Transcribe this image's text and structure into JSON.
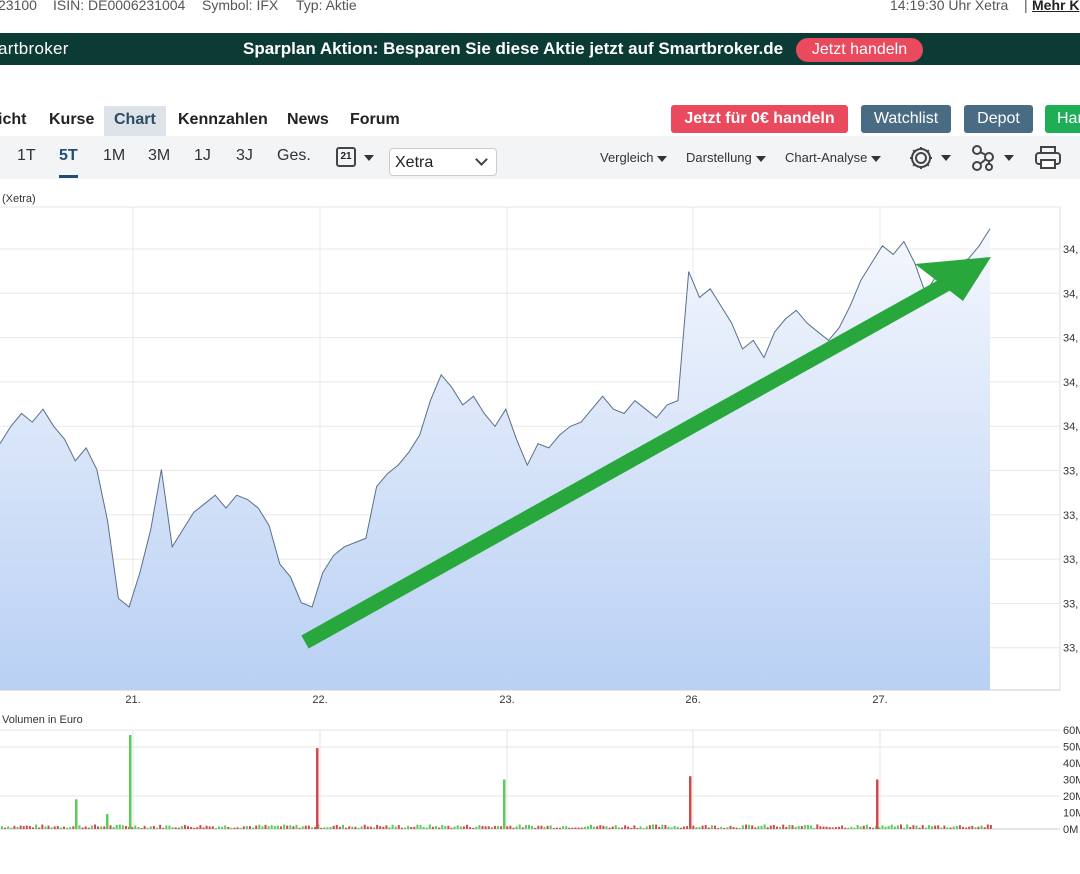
{
  "top_info": {
    "wkn": "23100",
    "isin": "ISIN: DE0006231004",
    "symbol": "Symbol: IFX",
    "type": "Typ: Aktie",
    "time": "14:19:30 Uhr Xetra",
    "separator": "|",
    "more": "Mehr K"
  },
  "banner": {
    "brand": "artbroker",
    "promo": "Sparplan Aktion: Besparen Sie diese Aktie jetzt auf Smartbroker.de",
    "trade_button": "Jetzt handeln"
  },
  "tabs": [
    {
      "label": "icht"
    },
    {
      "label": "Kurse"
    },
    {
      "label": "Chart"
    },
    {
      "label": "Kennzahlen"
    },
    {
      "label": "News"
    },
    {
      "label": "Forum"
    }
  ],
  "actions": {
    "trade_free": "Jetzt für 0€ handeln",
    "watchlist": "Watchlist",
    "depot": "Depot",
    "handel": "Han"
  },
  "periods": [
    "1T",
    "5T",
    "1M",
    "3M",
    "1J",
    "3J",
    "Ges."
  ],
  "active_period": "5T",
  "calendar_day": "21",
  "exchange_select": "Xetra",
  "dropdowns": {
    "compare": "Vergleich",
    "display": "Darstellung",
    "analysis": "Chart-Analyse"
  },
  "icons": {
    "calendar": "calendar-icon",
    "settings": "gear-icon",
    "indicators": "network-icon",
    "print": "printer-icon"
  },
  "colors": {
    "banner_bg": "#0b3b34",
    "trade_red": "#ea4a5e",
    "slate_button": "#4a6b84",
    "green_button": "#1fae58",
    "active_tab": "#2c4a63",
    "price_line": "#5a6f8c",
    "arrow": "#28a83c",
    "vol_up": "#5ccb5c",
    "vol_down": "#d14a4a"
  },
  "chart_data": {
    "type": "area",
    "title": "(Xetra)",
    "x_tick_labels": [
      "21.",
      "22.",
      "23.",
      "26.",
      "27."
    ],
    "y_tick_labels": [
      "34,",
      "34,",
      "34,",
      "34,",
      "34,",
      "33,",
      "33,",
      "33,",
      "33,",
      "33,"
    ],
    "y_tick_labels_note": "tick labels are cut off at the right edge of the screenshot",
    "price_relative_series": [
      0.48,
      0.52,
      0.55,
      0.53,
      0.56,
      0.52,
      0.49,
      0.44,
      0.47,
      0.42,
      0.3,
      0.12,
      0.1,
      0.18,
      0.28,
      0.42,
      0.24,
      0.28,
      0.32,
      0.34,
      0.36,
      0.33,
      0.36,
      0.35,
      0.33,
      0.29,
      0.2,
      0.17,
      0.11,
      0.1,
      0.18,
      0.22,
      0.24,
      0.25,
      0.26,
      0.38,
      0.41,
      0.43,
      0.46,
      0.5,
      0.58,
      0.64,
      0.61,
      0.57,
      0.59,
      0.55,
      0.52,
      0.56,
      0.49,
      0.43,
      0.48,
      0.47,
      0.5,
      0.52,
      0.53,
      0.56,
      0.59,
      0.56,
      0.55,
      0.58,
      0.56,
      0.54,
      0.57,
      0.58,
      0.88,
      0.82,
      0.84,
      0.8,
      0.76,
      0.7,
      0.72,
      0.68,
      0.74,
      0.77,
      0.79,
      0.76,
      0.74,
      0.72,
      0.75,
      0.8,
      0.86,
      0.9,
      0.94,
      0.92,
      0.95,
      0.9,
      0.83,
      0.87,
      0.89,
      0.9,
      0.91,
      0.94,
      0.98
    ],
    "volume": {
      "label": "Volumen in Euro",
      "y_tick_labels": [
        "60M",
        "50M",
        "40M",
        "30M",
        "20M",
        "10M",
        "0M"
      ],
      "ylim": [
        0,
        60
      ],
      "spikes": [
        {
          "day_label": "21.",
          "value": 57,
          "direction": "up"
        },
        {
          "day_label": "22.",
          "value": 49,
          "direction": "down"
        },
        {
          "day_label": "23.",
          "value": 30,
          "direction": "up"
        },
        {
          "day_label": "26.",
          "value": 32,
          "direction": "down"
        },
        {
          "day_label": "27.",
          "value": 30,
          "direction": "down"
        }
      ],
      "notable_bars": [
        {
          "position": "before 21.",
          "value": 18,
          "direction": "up"
        },
        {
          "position": "before 21.",
          "value": 9,
          "direction": "up"
        }
      ]
    },
    "annotation": "green upward arrow overlay",
    "grid": true
  }
}
